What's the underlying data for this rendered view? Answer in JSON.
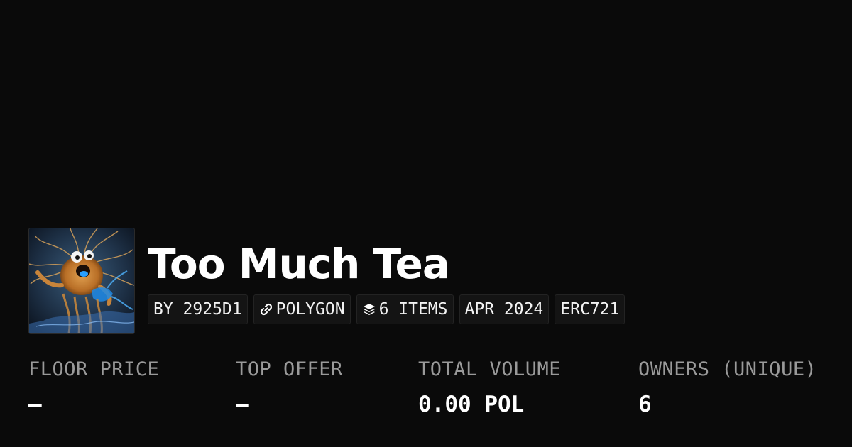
{
  "collection": {
    "title": "Too Much Tea",
    "tags": {
      "creator": "BY 2925D1",
      "chain": "POLYGON",
      "items": "6 ITEMS",
      "date": "APR 2024",
      "standard": "ERC721"
    }
  },
  "stats": {
    "floor_price": {
      "label": "FLOOR PRICE",
      "value": "–"
    },
    "top_offer": {
      "label": "TOP OFFER",
      "value": "–"
    },
    "total_volume": {
      "label": "TOTAL VOLUME",
      "value": "0.00 POL"
    },
    "owners": {
      "label": "OWNERS (UNIQUE)",
      "value": "6"
    }
  },
  "icons": {
    "chain": "chain-link-icon",
    "items": "layers-icon"
  },
  "colors": {
    "background": "#0a0a0a",
    "text": "#ffffff",
    "muted": "#9a9a9a",
    "tag_background": "#141414"
  }
}
